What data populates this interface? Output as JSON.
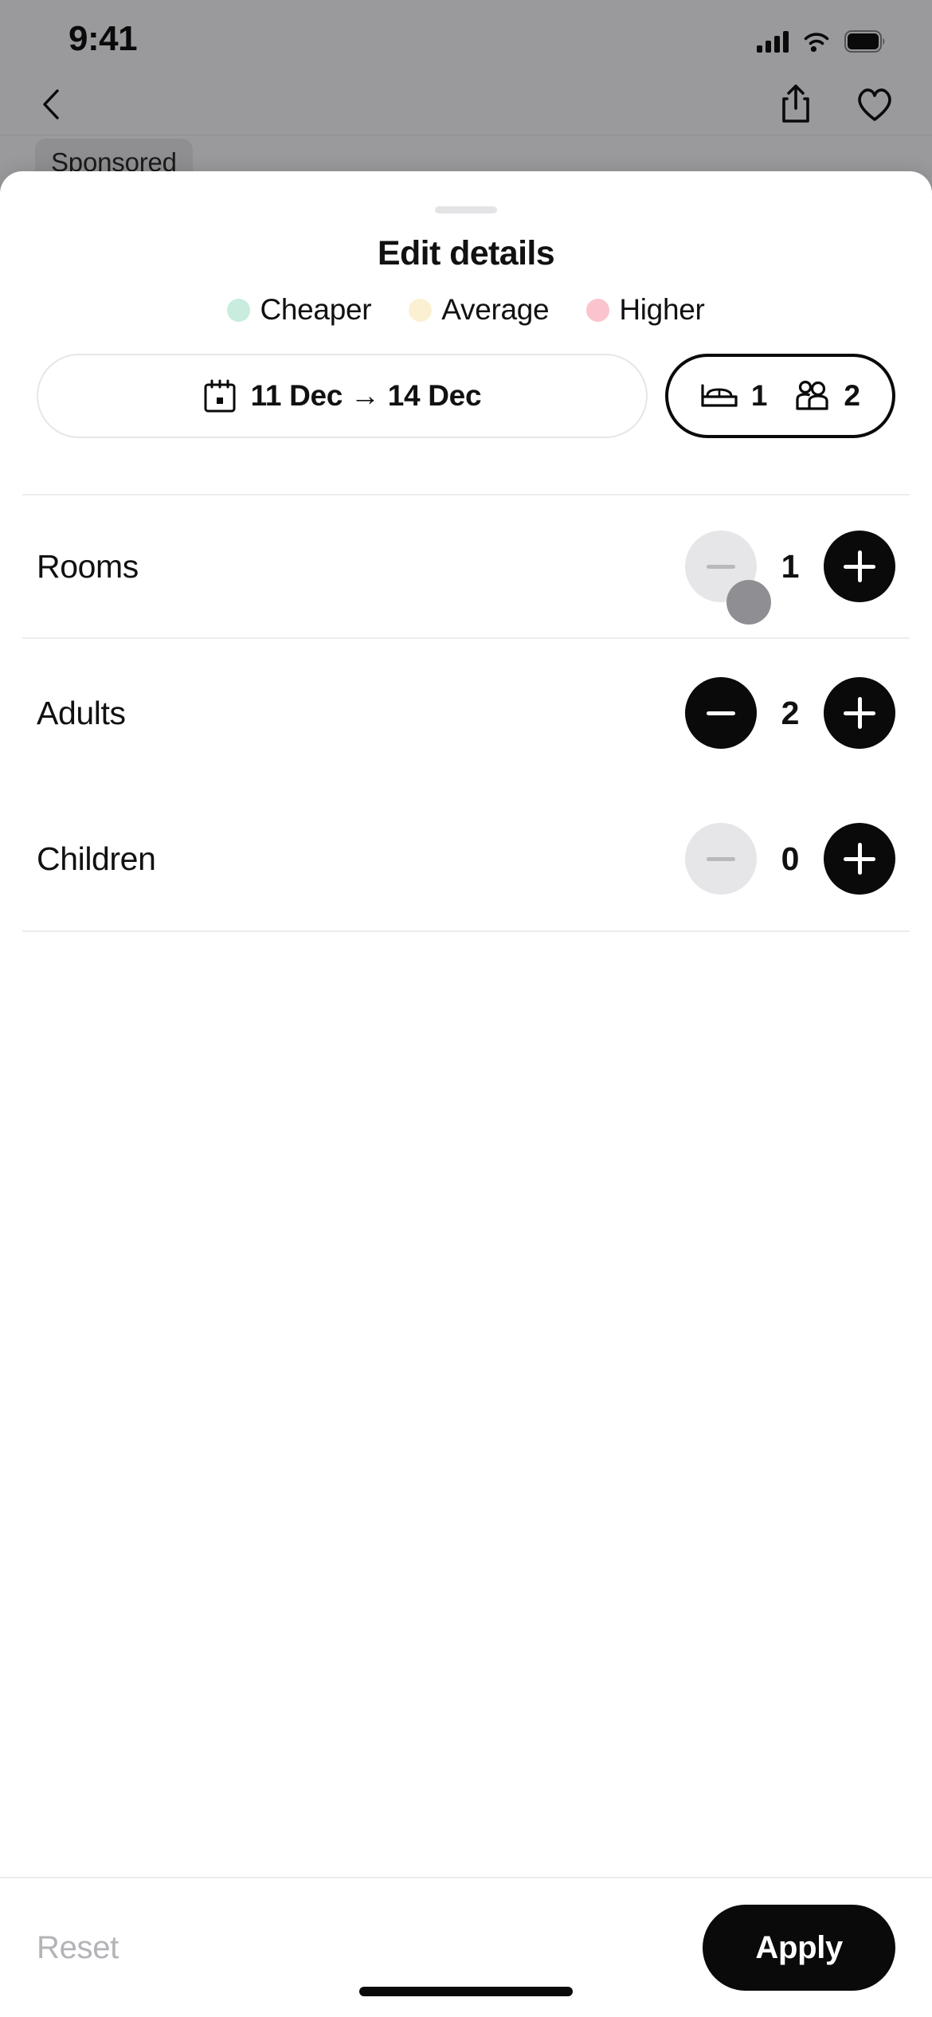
{
  "status_bar": {
    "time": "9:41",
    "icons": [
      "cellular-signal-icon",
      "wifi-icon",
      "battery-icon"
    ]
  },
  "nav_bar": {
    "back_icon": "chevron-left-icon",
    "share_icon": "share-icon",
    "favorite_icon": "heart-icon"
  },
  "background": {
    "sponsored_label": "Sponsored"
  },
  "sheet": {
    "title": "Edit details",
    "grabber": "drag-handle",
    "legend": [
      {
        "label": "Cheaper",
        "color": "#c8ecdd"
      },
      {
        "label": "Average",
        "color": "#fbf0d2"
      },
      {
        "label": "Higher",
        "color": "#fbc4cd"
      }
    ],
    "pills": {
      "date": {
        "icon": "calendar-icon",
        "text": "11 Dec → 14 Dec",
        "selected": false
      },
      "guests": {
        "selected": true,
        "rooms_icon": "bed-icon",
        "rooms_value": "1",
        "people_icon": "people-icon",
        "people_value": "2"
      }
    },
    "steppers": [
      {
        "label": "Rooms",
        "value": "1",
        "decrement_enabled": false,
        "increment_enabled": true,
        "decrement_icon": "minus-icon",
        "increment_icon": "plus-icon"
      },
      {
        "label": "Adults",
        "value": "2",
        "decrement_enabled": true,
        "increment_enabled": true,
        "decrement_icon": "minus-icon",
        "increment_icon": "plus-icon"
      },
      {
        "label": "Children",
        "value": "0",
        "decrement_enabled": false,
        "increment_enabled": true,
        "decrement_icon": "minus-icon",
        "increment_icon": "plus-icon"
      }
    ],
    "footer": {
      "reset_label": "Reset",
      "apply_label": "Apply"
    }
  },
  "colors": {
    "accent": "#0a0a0a",
    "disabled": "#e6e5e8",
    "muted_text": "#b4b3b8",
    "backdrop": "#9a9a9d"
  }
}
